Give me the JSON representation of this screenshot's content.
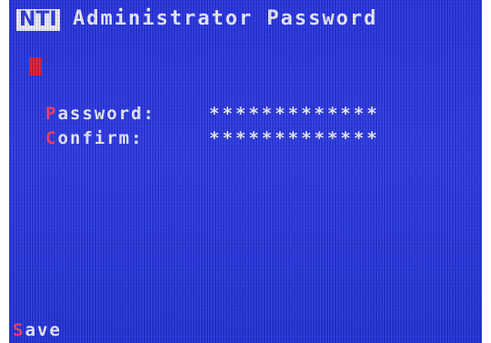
{
  "logo": "NTI",
  "title": "Administrator Password",
  "fields": [
    {
      "hotkey": "P",
      "label_rest": "assword:",
      "value": "*************"
    },
    {
      "hotkey": "C",
      "label_rest": "onfirm:",
      "value": "*************"
    }
  ],
  "footer": {
    "hotkey": "S",
    "label_rest": "ave"
  },
  "colors": {
    "background": "#2f3cea",
    "text": "#f4f4ff",
    "hotkey": "#ff3e6e",
    "cursor": "#e0203a"
  }
}
